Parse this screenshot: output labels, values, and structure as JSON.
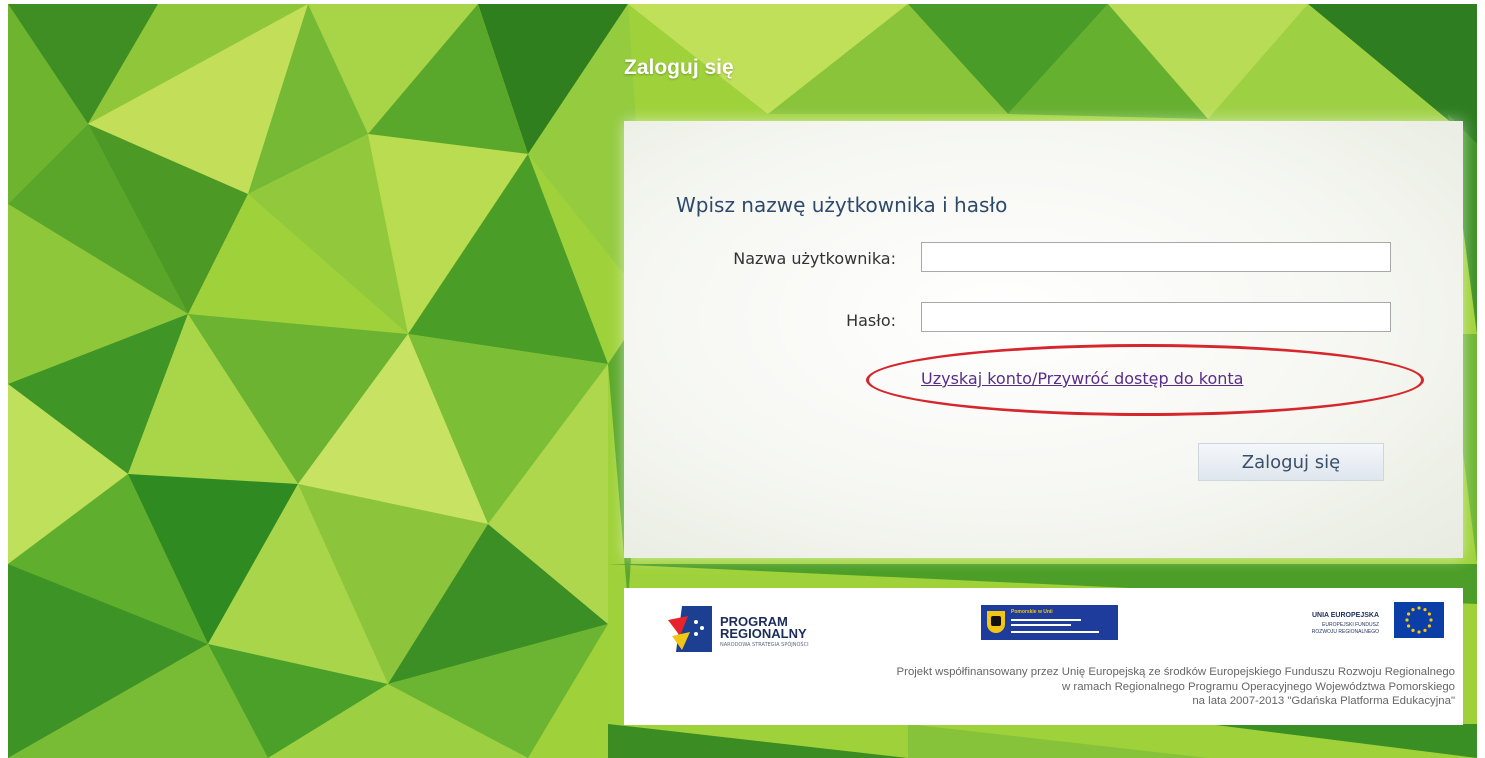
{
  "page": {
    "title": "Zaloguj się"
  },
  "login": {
    "heading": "Wpisz nazwę użytkownika i hasło",
    "username_label": "Nazwa użytkownika:",
    "username_value": "",
    "password_label": "Hasło:",
    "password_value": "",
    "recovery_link": "Uzyskaj konto/Przywróć dostęp do konta",
    "submit_label": "Zaloguj się"
  },
  "footer": {
    "program_logo_line1": "PROGRAM",
    "program_logo_line2": "REGIONALNY",
    "program_logo_sub": "NARODOWA STRATEGIA SPÓJNOŚCI",
    "pomorskie_logo_title": "Pomorskie w Unii",
    "eu_logo_line1": "UNIA EUROPEJSKA",
    "eu_logo_line2": "EUROPEJSKI FUNDUSZ",
    "eu_logo_line3": "ROZWOJU REGIONALNEGO",
    "project_text": [
      "Projekt współfinansowany przez Unię Europejską ze środków Europejskiego Funduszu Rozwoju Regionalnego",
      "w ramach Regionalnego Programu Operacyjnego Województwa Pomorskiego",
      "na lata 2007-2013 \"Gdańska Platforma Edukacyjna\""
    ]
  },
  "colors": {
    "background_green": "#9fd23a",
    "highlight_red": "#d6262c",
    "link_purple": "#5a2d8a",
    "eu_blue": "#0b3ea6",
    "eu_star_yellow": "#f2c615"
  }
}
